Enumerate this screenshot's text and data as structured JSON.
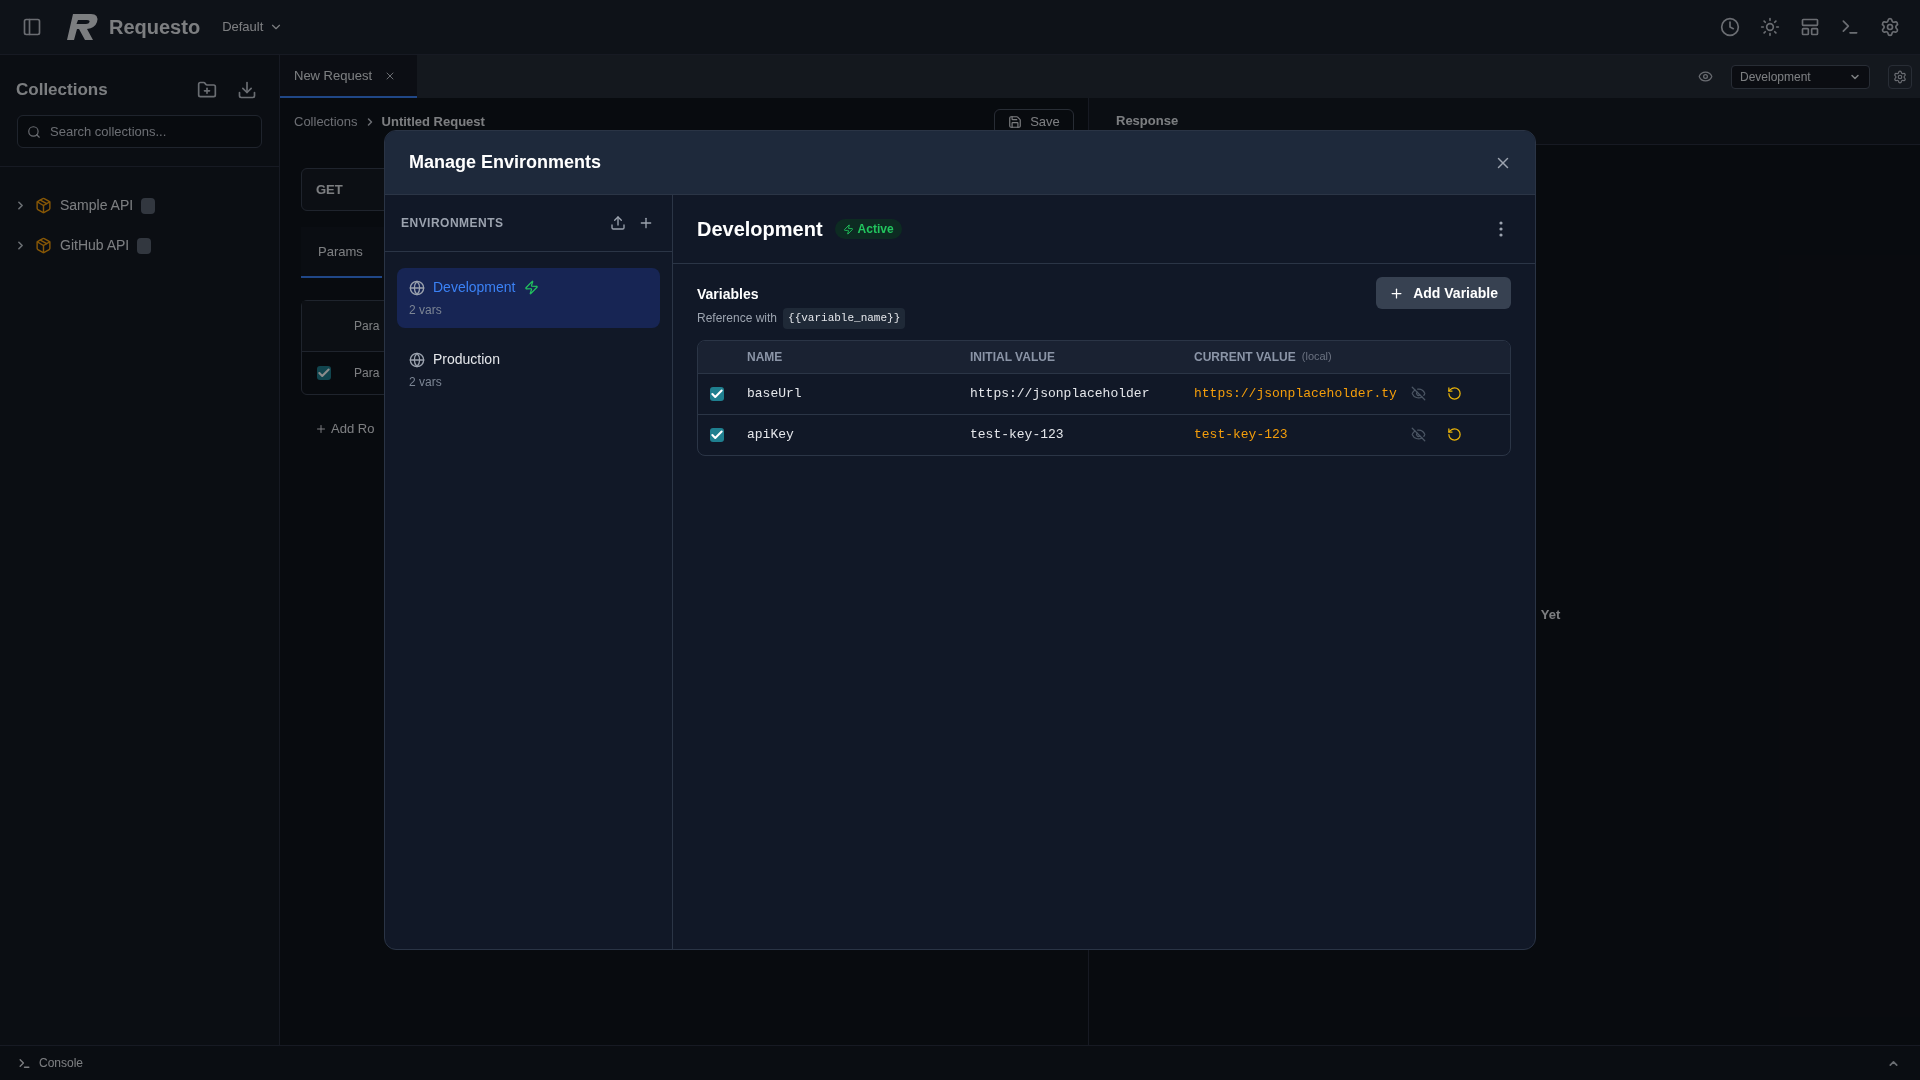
{
  "app_bar": {
    "title": "Requesto",
    "workspace": "Default"
  },
  "sidebar": {
    "title": "Collections",
    "search": {
      "placeholder": "Search collections..."
    },
    "collections": [
      {
        "name": "Sample API",
        "expanded": false
      },
      {
        "name": "GitHub API",
        "expanded": false
      }
    ]
  },
  "tabs": [
    {
      "label": "New Request",
      "selected": true
    }
  ],
  "environment_select": {
    "value": "Development"
  },
  "request": {
    "breadcrumb": [
      "Collections",
      "Untitled Request"
    ],
    "save": "Save",
    "method": "GET",
    "tabs": [
      {
        "label": "Params",
        "selected": true
      }
    ],
    "params": {
      "column_1": "Para",
      "rows": [
        {
          "checked": true,
          "key": "Para"
        }
      ]
    },
    "add_row": "Add Ro"
  },
  "response": {
    "title": "Response",
    "empty_text": "Yet"
  },
  "console": {
    "label": "Console"
  },
  "modal": {
    "title": "Manage Environments",
    "sidebar_title": "ENVIRONMENTS",
    "environments": [
      {
        "name": "Development",
        "vars": "2 vars",
        "selected": true,
        "active": true
      },
      {
        "name": "Production",
        "vars": "2 vars",
        "selected": false,
        "active": false
      }
    ],
    "detail": {
      "title": "Development",
      "badge": "Active",
      "variables_title": "Variables",
      "hint": "Reference with",
      "syntax": "{{variable_name}}",
      "add_button": "Add Variable",
      "columns": [
        "NAME",
        "INITIAL VALUE",
        "CURRENT VALUE"
      ],
      "column_note": "(local)",
      "rows": [
        {
          "enabled": true,
          "name": "baseUrl",
          "initial_value": "https://jsonplaceholder",
          "current_value": "https://jsonplaceholder.ty"
        },
        {
          "enabled": true,
          "name": "apiKey",
          "initial_value": "test-key-123",
          "current_value": "test-key-123"
        }
      ]
    }
  }
}
